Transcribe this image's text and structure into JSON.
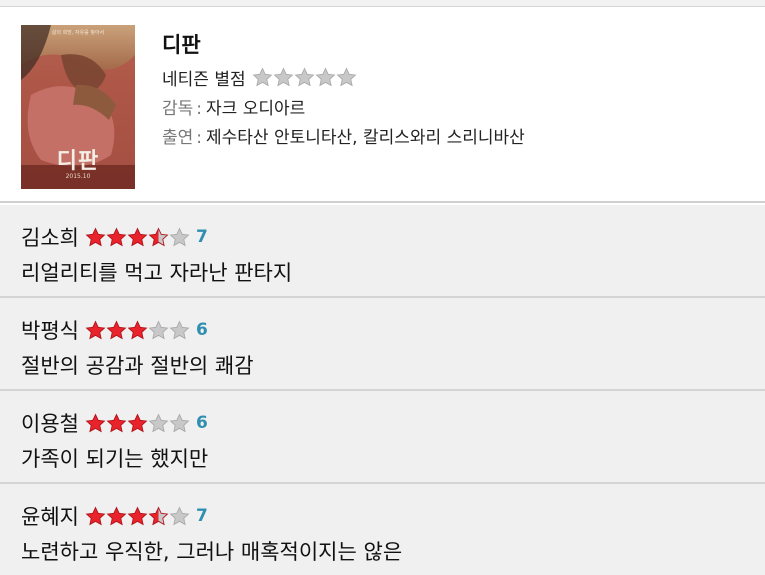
{
  "movie": {
    "title": "디판",
    "poster": {
      "title": "디판",
      "tagline": "삶의 희망, 자유를 찾아서",
      "date": "2015.10"
    },
    "rating_label": "네티즌 별점",
    "rating_stars": 0,
    "director_label": "감독",
    "director": "자크 오디아르",
    "cast_label": "출연",
    "cast": "제수타산 안토니타산, 칼리스와리 스리니바산",
    "separator": ":"
  },
  "reviews": [
    {
      "critic": "김소희",
      "stars": 3.5,
      "score": "7",
      "comment": "리얼리티를 먹고 자라난 판타지"
    },
    {
      "critic": "박평식",
      "stars": 3,
      "score": "6",
      "comment": "절반의 공감과 절반의 쾌감"
    },
    {
      "critic": "이용철",
      "stars": 3,
      "score": "6",
      "comment": "가족이 되기는 했지만"
    },
    {
      "critic": "윤혜지",
      "stars": 3.5,
      "score": "7",
      "comment": "노련하고 우직한, 그러나 매혹적이지는 않은"
    }
  ],
  "colors": {
    "star_filled": "#e8232b",
    "star_empty": "#c8c8c8",
    "score": "#2f8fb0",
    "review_bg": "#f0f0f0"
  }
}
